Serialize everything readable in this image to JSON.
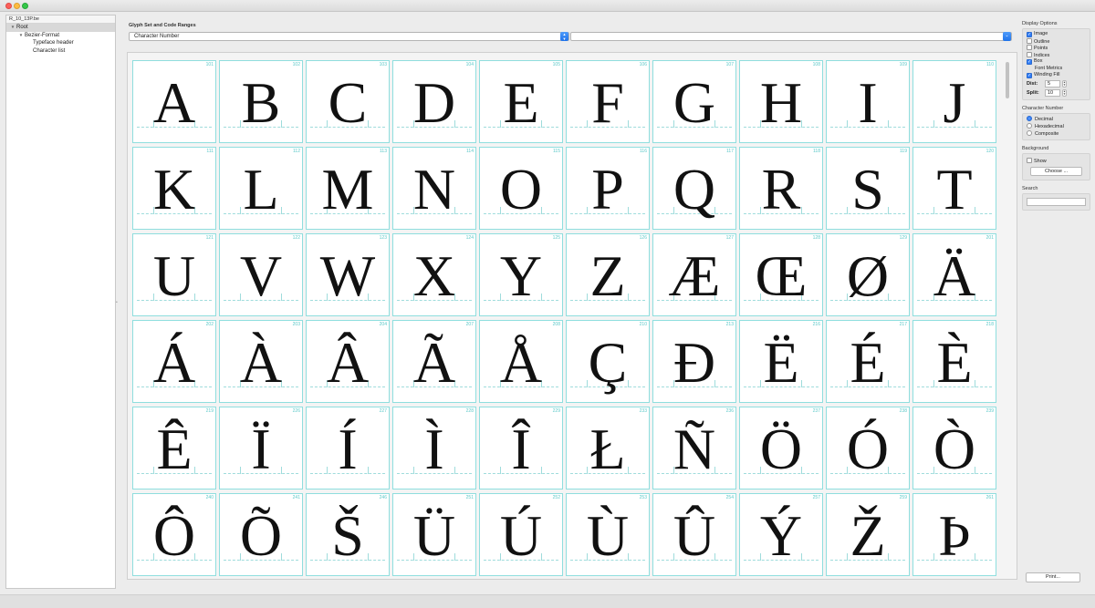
{
  "window": {
    "title": ""
  },
  "sidebar": {
    "header": "R_10_13P.be",
    "tree": [
      {
        "label": "Root",
        "level": 0,
        "expanded": true,
        "selected": true
      },
      {
        "label": "Bezier-Format",
        "level": 1,
        "expanded": true,
        "selected": false
      },
      {
        "label": "Typeface header",
        "level": 2,
        "expanded": false,
        "selected": false
      },
      {
        "label": "Character list",
        "level": 2,
        "expanded": false,
        "selected": false
      }
    ]
  },
  "main": {
    "section_label": "Glyph Set and Code Ranges",
    "glyph_set_select": "Character Number",
    "code_range_select": ""
  },
  "glyph_grid": [
    {
      "num": "101",
      "glyph": "A"
    },
    {
      "num": "102",
      "glyph": "B"
    },
    {
      "num": "103",
      "glyph": "C"
    },
    {
      "num": "104",
      "glyph": "D"
    },
    {
      "num": "105",
      "glyph": "E"
    },
    {
      "num": "106",
      "glyph": "F"
    },
    {
      "num": "107",
      "glyph": "G"
    },
    {
      "num": "108",
      "glyph": "H"
    },
    {
      "num": "109",
      "glyph": "I"
    },
    {
      "num": "110",
      "glyph": "J"
    },
    {
      "num": "111",
      "glyph": "K"
    },
    {
      "num": "112",
      "glyph": "L"
    },
    {
      "num": "113",
      "glyph": "M"
    },
    {
      "num": "114",
      "glyph": "N"
    },
    {
      "num": "115",
      "glyph": "O"
    },
    {
      "num": "116",
      "glyph": "P"
    },
    {
      "num": "117",
      "glyph": "Q"
    },
    {
      "num": "118",
      "glyph": "R"
    },
    {
      "num": "119",
      "glyph": "S"
    },
    {
      "num": "120",
      "glyph": "T"
    },
    {
      "num": "121",
      "glyph": "U"
    },
    {
      "num": "122",
      "glyph": "V"
    },
    {
      "num": "123",
      "glyph": "W"
    },
    {
      "num": "124",
      "glyph": "X"
    },
    {
      "num": "125",
      "glyph": "Y"
    },
    {
      "num": "126",
      "glyph": "Z"
    },
    {
      "num": "127",
      "glyph": "Æ"
    },
    {
      "num": "128",
      "glyph": "Œ"
    },
    {
      "num": "129",
      "glyph": "Ø"
    },
    {
      "num": "201",
      "glyph": "Ä"
    },
    {
      "num": "202",
      "glyph": "Á"
    },
    {
      "num": "203",
      "glyph": "À"
    },
    {
      "num": "204",
      "glyph": "Â"
    },
    {
      "num": "207",
      "glyph": "Ã"
    },
    {
      "num": "208",
      "glyph": "Å"
    },
    {
      "num": "210",
      "glyph": "Ç"
    },
    {
      "num": "213",
      "glyph": "Đ"
    },
    {
      "num": "216",
      "glyph": "Ë"
    },
    {
      "num": "217",
      "glyph": "É"
    },
    {
      "num": "218",
      "glyph": "È"
    },
    {
      "num": "219",
      "glyph": "Ê"
    },
    {
      "num": "226",
      "glyph": "Ï"
    },
    {
      "num": "227",
      "glyph": "Í"
    },
    {
      "num": "228",
      "glyph": "Ì"
    },
    {
      "num": "229",
      "glyph": "Î"
    },
    {
      "num": "233",
      "glyph": "Ł"
    },
    {
      "num": "236",
      "glyph": "Ñ"
    },
    {
      "num": "237",
      "glyph": "Ö"
    },
    {
      "num": "238",
      "glyph": "Ó"
    },
    {
      "num": "239",
      "glyph": "Ò"
    },
    {
      "num": "240",
      "glyph": "Ô"
    },
    {
      "num": "241",
      "glyph": "Õ"
    },
    {
      "num": "246",
      "glyph": "Š"
    },
    {
      "num": "251",
      "glyph": "Ü"
    },
    {
      "num": "252",
      "glyph": "Ú"
    },
    {
      "num": "253",
      "glyph": "Ù"
    },
    {
      "num": "254",
      "glyph": "Û"
    },
    {
      "num": "257",
      "glyph": "Ý"
    },
    {
      "num": "259",
      "glyph": "Ž"
    },
    {
      "num": "261",
      "glyph": "Þ"
    }
  ],
  "display_options": {
    "title": "Display Options",
    "image": {
      "label": "Image",
      "checked": true
    },
    "outline": {
      "label": "Outline",
      "checked": false
    },
    "points": {
      "label": "Points",
      "checked": false
    },
    "indices": {
      "label": "Indices",
      "checked": false
    },
    "box": {
      "label": "Box",
      "checked": true
    },
    "font_metrics": {
      "label": "Font Metrics"
    },
    "winding_fill": {
      "label": "Winding Fill",
      "checked": true
    },
    "dist_label": "Dist:",
    "dist_value": "5",
    "split_label": "Split:",
    "split_value": "10"
  },
  "character_number": {
    "title": "Character Number",
    "options": [
      {
        "label": "Decimal",
        "selected": true
      },
      {
        "label": "Hexadecimal",
        "selected": false
      },
      {
        "label": "Composite",
        "selected": false
      }
    ]
  },
  "background": {
    "title": "Background",
    "show_label": "Show",
    "choose_label": "Choose ..."
  },
  "search": {
    "title": "Search",
    "value": ""
  },
  "print_label": "Print...",
  "colors": {
    "accent": "#2f7cf6",
    "grid_line": "#8fdede",
    "index_text": "#5bc8c8"
  }
}
